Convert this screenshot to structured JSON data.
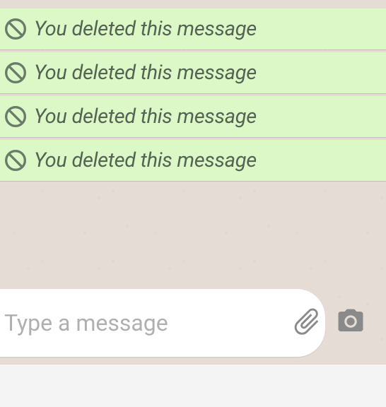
{
  "messages": [
    {
      "deleted_text": "You deleted this message"
    },
    {
      "deleted_text": "You deleted this message"
    },
    {
      "deleted_text": "You deleted this message"
    },
    {
      "deleted_text": "You deleted this message"
    }
  ],
  "input": {
    "placeholder": "Type a message"
  }
}
